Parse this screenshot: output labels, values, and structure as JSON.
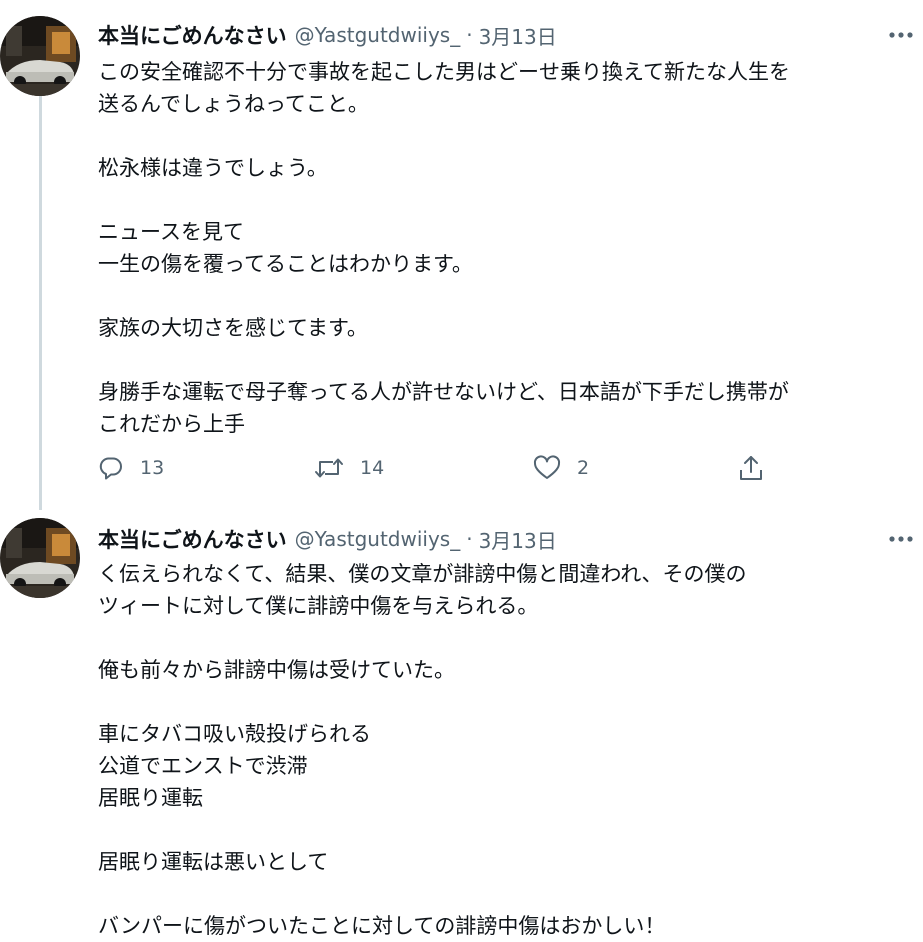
{
  "tweets": [
    {
      "display_name": "本当にごめんなさい",
      "handle": "@Yastgutdwiiys_",
      "separator": "·",
      "date": "3月13日",
      "text": "この安全確認不十分で事故を起こした男はどーせ乗り換えて新たな人生を\n送るんでしょうねってこと。\n\n松永様は違うでしょう。\n\nニュースを見て\n一生の傷を覆ってることはわかります。\n\n家族の大切さを感じてます。\n\n身勝手な運転で母子奪ってる人が許せないけど、日本語が下手だし携帯が\nこれだから上手",
      "reply_count": "13",
      "retweet_count": "14",
      "like_count": "2"
    },
    {
      "display_name": "本当にごめんなさい",
      "handle": "@Yastgutdwiiys_",
      "separator": "·",
      "date": "3月13日",
      "text": "く伝えられなくて、結果、僕の文章が誹謗中傷と間違われ、その僕の\nツィートに対して僕に誹謗中傷を与えられる。\n\n俺も前々から誹謗中傷は受けていた。\n\n車にタバコ吸い殻投げられる\n公道でエンストで渋滞\n居眠り運転\n\n居眠り運転は悪いとして\n\nバンパーに傷がついたことに対しての誹謗中傷はおかしい！"
    }
  ],
  "icons": {
    "more": "more-horizontal-icon",
    "reply": "reply-bubble-icon",
    "retweet": "retweet-arrows-icon",
    "like": "heart-icon",
    "share": "share-upload-icon"
  },
  "colors": {
    "text": "#0f1419",
    "secondary": "#536471",
    "thread_line": "#cfd9de"
  }
}
